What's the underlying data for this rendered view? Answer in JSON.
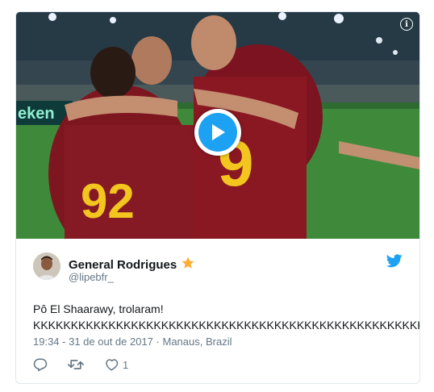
{
  "media": {
    "info_icon": "info-icon",
    "play_icon": "play-icon"
  },
  "tweet": {
    "author_name": "General Rodrigues",
    "author_badge": "star-icon",
    "handle": "@lipebfr_",
    "text_line1": "Pô El Shaarawy, trolaram!",
    "text_line2": "KKKKKKKKKKKKKKKKKKKKKKKKKKKKKKKKKKKKKKKKKKKKKKKKKKKK",
    "timestamp": "19:34 - 31 de out de 2017",
    "separator": "·",
    "location": "Manaus, Brazil",
    "like_count": "1"
  },
  "colors": {
    "accent": "#1da1f2",
    "star": "#ffac33",
    "muted": "#657786",
    "border": "#e1e8ed"
  }
}
